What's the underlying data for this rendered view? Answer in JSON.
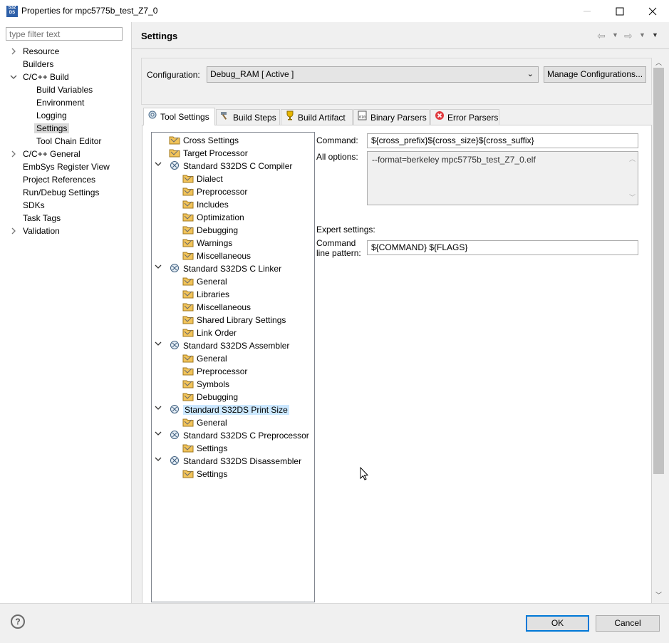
{
  "window": {
    "icon_text": "S32\nDS",
    "title": "Properties for mpc5775b_test_Z7_0",
    "minimize": "—",
    "maximize": "☐",
    "close": "✕"
  },
  "left_panel": {
    "filter_placeholder": "type filter text",
    "items": [
      {
        "label": "Resource",
        "arrow": "›"
      },
      {
        "label": "Builders"
      },
      {
        "label": "C/C++ Build",
        "arrow": "⌄"
      },
      {
        "label": "Build Variables"
      },
      {
        "label": "Environment"
      },
      {
        "label": "Logging"
      },
      {
        "label": "Settings"
      },
      {
        "label": "Tool Chain Editor"
      },
      {
        "label": "C/C++ General",
        "arrow": "›"
      },
      {
        "label": "EmbSys Register View"
      },
      {
        "label": "Project References"
      },
      {
        "label": "Run/Debug Settings"
      },
      {
        "label": "SDKs"
      },
      {
        "label": "Task Tags"
      },
      {
        "label": "Validation",
        "arrow": "›"
      }
    ]
  },
  "header": {
    "title": "Settings",
    "nav_back": "⇦",
    "nav_forward": "⇨",
    "dropdown": "▾",
    "menu": "▾"
  },
  "configuration": {
    "label": "Configuration:",
    "value": "Debug_RAM  [ Active ]",
    "manage_label": "Manage Configurations..."
  },
  "tabs": [
    {
      "label": "Tool Settings",
      "icon": "gear-icon"
    },
    {
      "label": "Build Steps",
      "icon": "hammer-icon"
    },
    {
      "label": "Build Artifact",
      "icon": "trophy-icon"
    },
    {
      "label": "Binary Parsers",
      "icon": "binary-icon"
    },
    {
      "label": "Error Parsers",
      "icon": "error-icon"
    }
  ],
  "tree": [
    {
      "label": "Cross Settings",
      "level": 1
    },
    {
      "label": "Target Processor",
      "level": 1
    },
    {
      "label": "Standard S32DS C Compiler",
      "level": 1,
      "expanded": true
    },
    {
      "label": "Dialect",
      "level": 2
    },
    {
      "label": "Preprocessor",
      "level": 2
    },
    {
      "label": "Includes",
      "level": 2
    },
    {
      "label": "Optimization",
      "level": 2
    },
    {
      "label": "Debugging",
      "level": 2
    },
    {
      "label": "Warnings",
      "level": 2
    },
    {
      "label": "Miscellaneous",
      "level": 2
    },
    {
      "label": "Standard S32DS C Linker",
      "level": 1,
      "expanded": true
    },
    {
      "label": "General",
      "level": 2
    },
    {
      "label": "Libraries",
      "level": 2
    },
    {
      "label": "Miscellaneous",
      "level": 2
    },
    {
      "label": "Shared Library Settings",
      "level": 2
    },
    {
      "label": "Link Order",
      "level": 2
    },
    {
      "label": "Standard S32DS Assembler",
      "level": 1,
      "expanded": true
    },
    {
      "label": "General",
      "level": 2
    },
    {
      "label": "Preprocessor",
      "level": 2
    },
    {
      "label": "Symbols",
      "level": 2
    },
    {
      "label": "Debugging",
      "level": 2
    },
    {
      "label": "Standard S32DS Print Size",
      "level": 1,
      "expanded": true,
      "selected": true
    },
    {
      "label": "General",
      "level": 2
    },
    {
      "label": "Standard S32DS C Preprocessor",
      "level": 1,
      "expanded": true
    },
    {
      "label": "Settings",
      "level": 2
    },
    {
      "label": "Standard S32DS Disassembler",
      "level": 1,
      "expanded": true
    },
    {
      "label": "Settings",
      "level": 2
    }
  ],
  "fields": {
    "command_label": "Command:",
    "command_value": "${cross_prefix}${cross_size}${cross_suffix}",
    "all_options_label": "All options:",
    "all_options_value": "--format=berkeley mpc5775b_test_Z7_0.elf",
    "expert_label": "Expert settings:",
    "cmdline_label_1": "Command",
    "cmdline_label_2": "line pattern:",
    "cmdline_value": "${COMMAND} ${FLAGS}"
  },
  "footer": {
    "help": "?",
    "ok_label": "OK",
    "cancel_label": "Cancel"
  }
}
